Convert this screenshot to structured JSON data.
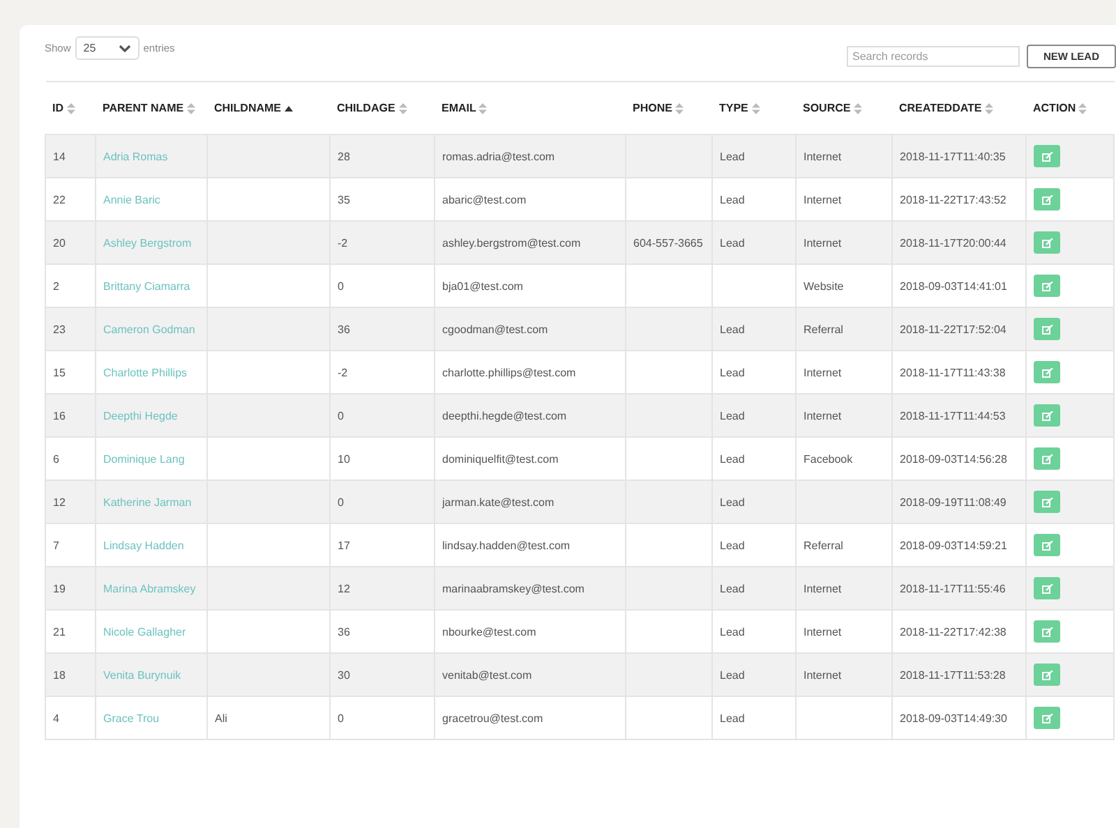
{
  "length_control": {
    "label_before": "Show",
    "value": "25",
    "label_after": "entries"
  },
  "search": {
    "placeholder": "Search records"
  },
  "new_button": "NEW LEAD",
  "table": {
    "columns": [
      {
        "label": "ID",
        "sorted": false
      },
      {
        "label": "PARENT NAME",
        "sorted": false
      },
      {
        "label": "CHILDNAME",
        "sorted": true
      },
      {
        "label": "CHILDAGE",
        "sorted": false
      },
      {
        "label": "EMAIL",
        "sorted": false
      },
      {
        "label": "PHONE",
        "sorted": false
      },
      {
        "label": "TYPE",
        "sorted": false
      },
      {
        "label": "SOURCE",
        "sorted": false
      },
      {
        "label": "CREATEDDATE",
        "sorted": false
      },
      {
        "label": "ACTION",
        "sorted": false
      }
    ],
    "rows": [
      {
        "id": "14",
        "parent": "Adria Romas",
        "child": "",
        "age": "28",
        "email": "romas.adria@test.com",
        "phone": "",
        "type": "Lead",
        "source": "Internet",
        "created": "2018-11-17T11:40:35"
      },
      {
        "id": "22",
        "parent": "Annie Baric",
        "child": "",
        "age": "35",
        "email": "abaric@test.com",
        "phone": "",
        "type": "Lead",
        "source": "Internet",
        "created": "2018-11-22T17:43:52"
      },
      {
        "id": "20",
        "parent": "Ashley Bergstrom",
        "child": "",
        "age": "-2",
        "email": "ashley.bergstrom@test.com",
        "phone": "604-557-3665",
        "type": "Lead",
        "source": "Internet",
        "created": "2018-11-17T20:00:44"
      },
      {
        "id": "2",
        "parent": "Brittany Ciamarra",
        "child": "",
        "age": "0",
        "email": "bja01@test.com",
        "phone": "",
        "type": "",
        "source": "Website",
        "created": "2018-09-03T14:41:01"
      },
      {
        "id": "23",
        "parent": "Cameron Godman",
        "child": "",
        "age": "36",
        "email": "cgoodman@test.com",
        "phone": "",
        "type": "Lead",
        "source": "Referral",
        "created": "2018-11-22T17:52:04"
      },
      {
        "id": "15",
        "parent": "Charlotte Phillips",
        "child": "",
        "age": "-2",
        "email": "charlotte.phillips@test.com",
        "phone": "",
        "type": "Lead",
        "source": "Internet",
        "created": "2018-11-17T11:43:38"
      },
      {
        "id": "16",
        "parent": "Deepthi Hegde",
        "child": "",
        "age": "0",
        "email": "deepthi.hegde@test.com",
        "phone": "",
        "type": "Lead",
        "source": "Internet",
        "created": "2018-11-17T11:44:53"
      },
      {
        "id": "6",
        "parent": "Dominique Lang",
        "child": "",
        "age": "10",
        "email": "dominiquelfit@test.com",
        "phone": "",
        "type": "Lead",
        "source": "Facebook",
        "created": "2018-09-03T14:56:28"
      },
      {
        "id": "12",
        "parent": "Katherine Jarman",
        "child": "",
        "age": "0",
        "email": "jarman.kate@test.com",
        "phone": "",
        "type": "Lead",
        "source": "",
        "created": "2018-09-19T11:08:49"
      },
      {
        "id": "7",
        "parent": "Lindsay Hadden",
        "child": "",
        "age": "17",
        "email": "lindsay.hadden@test.com",
        "phone": "",
        "type": "Lead",
        "source": "Referral",
        "created": "2018-09-03T14:59:21"
      },
      {
        "id": "19",
        "parent": "Marina Abramskey",
        "child": "",
        "age": "12",
        "email": "marinaabramskey@test.com",
        "phone": "",
        "type": "Lead",
        "source": "Internet",
        "created": "2018-11-17T11:55:46"
      },
      {
        "id": "21",
        "parent": "Nicole Gallagher",
        "child": "",
        "age": "36",
        "email": "nbourke@test.com",
        "phone": "",
        "type": "Lead",
        "source": "Internet",
        "created": "2018-11-22T17:42:38"
      },
      {
        "id": "18",
        "parent": "Venita Burynuik",
        "child": "",
        "age": "30",
        "email": "venitab@test.com",
        "phone": "",
        "type": "Lead",
        "source": "Internet",
        "created": "2018-11-17T11:53:28"
      },
      {
        "id": "4",
        "parent": "Grace Trou",
        "child": "Ali",
        "age": "0",
        "email": "gracetrou@test.com",
        "phone": "",
        "type": "Lead",
        "source": "",
        "created": "2018-09-03T14:49:30"
      }
    ]
  }
}
